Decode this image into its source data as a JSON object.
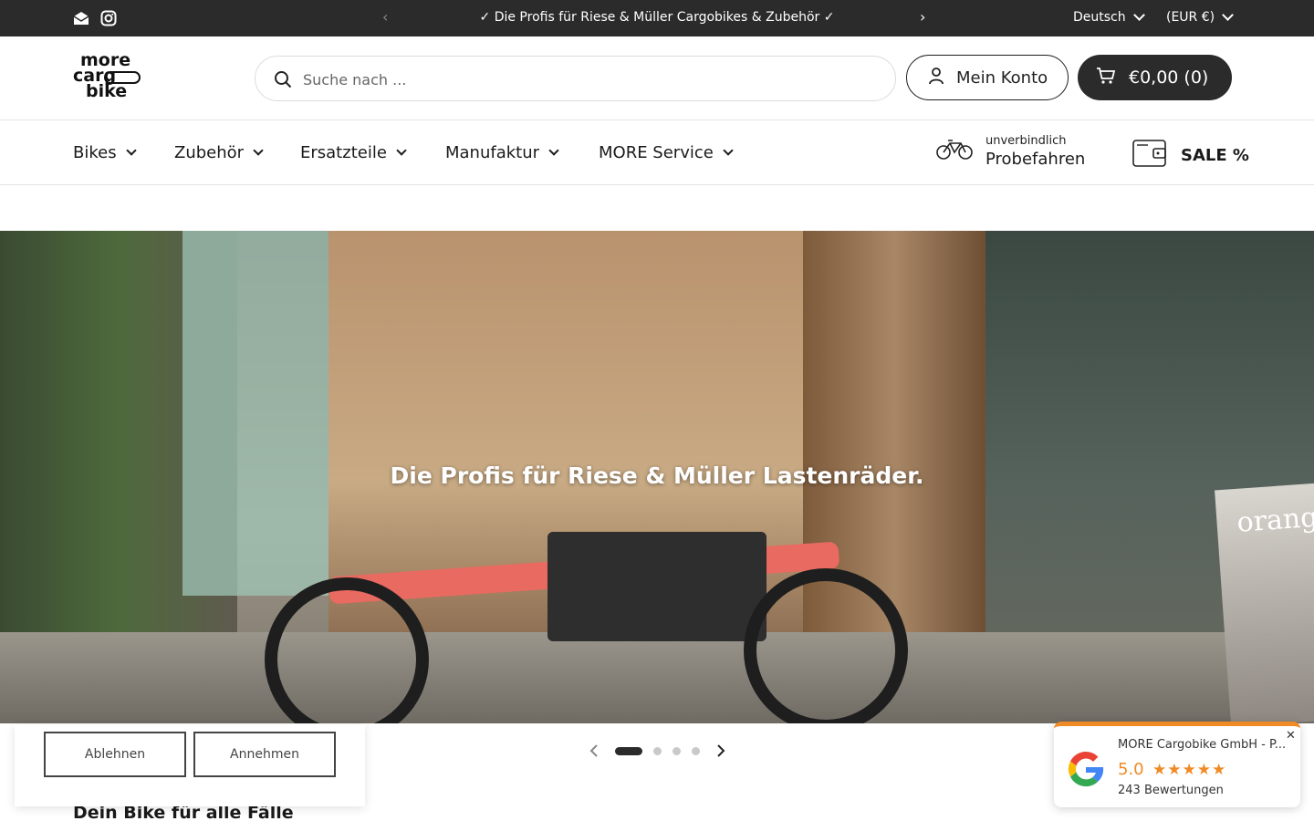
{
  "topbar": {
    "announcement": "✓ Die Profis für Riese & Müller Cargobikes & Zubehör ✓",
    "language": "Deutsch",
    "currency": "(EUR €)",
    "icons": [
      "mail-icon",
      "instagram-icon"
    ]
  },
  "header": {
    "logo": {
      "line1": "more",
      "line2": "carg",
      "line3": "bike"
    },
    "search_placeholder": "Suche nach ...",
    "account_label": "Mein Konto",
    "cart_label": "€0,00 (0)"
  },
  "nav": {
    "items": [
      {
        "label": "Bikes"
      },
      {
        "label": "Zubehör"
      },
      {
        "label": "Ersatzteile"
      },
      {
        "label": "Manufaktur"
      },
      {
        "label": "MORE Service"
      }
    ],
    "probe_small": "unverbindlich",
    "probe_big": "Probefahren",
    "sale_label": "SALE %"
  },
  "hero": {
    "caption": "Die Profis für Riese & Müller Lastenräder.",
    "sign_text": "orang",
    "slides_total": 4,
    "slide_active": 1
  },
  "cookie": {
    "reject_label": "Ablehnen",
    "accept_label": "Annehmen"
  },
  "section": {
    "heading": "Dein Bike für alle Fälle"
  },
  "review": {
    "company": "MORE Cargobike GmbH - P...",
    "score": "5.0",
    "stars": "★★★★★",
    "count": "243 Bewertungen",
    "close": "✕"
  },
  "colors": {
    "topbar_bg": "#2b2b2b",
    "cart_bg": "#2b2b2b",
    "review_accent": "#f08a24"
  }
}
